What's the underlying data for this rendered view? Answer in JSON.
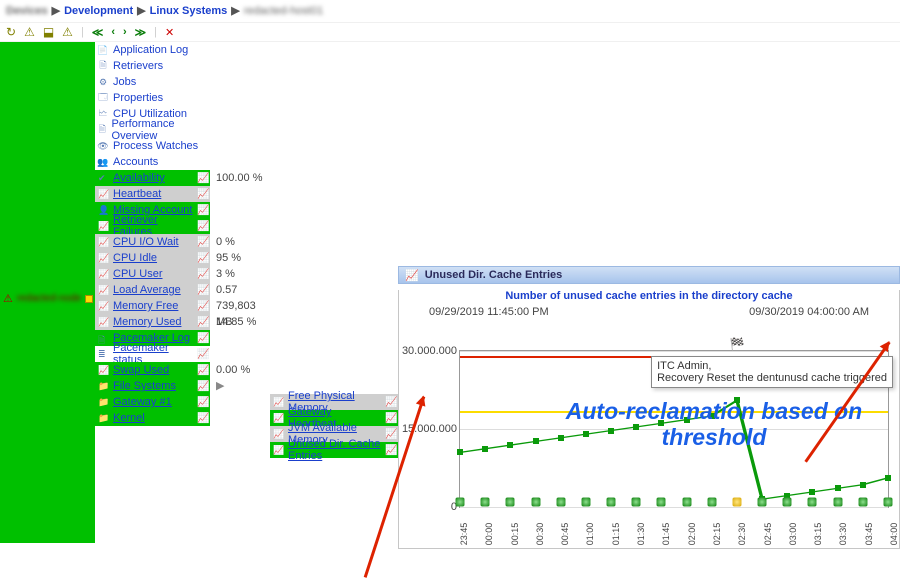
{
  "breadcrumb": {
    "l1": "Devices",
    "l2": "Development",
    "l3": "Linux Systems",
    "l4": "redacted-host01"
  },
  "tree": {
    "node": "redacted-node"
  },
  "nav_links": [
    {
      "icon": "📄",
      "label": "Application Log"
    },
    {
      "icon": "🗎",
      "label": "Retrievers"
    },
    {
      "icon": "⚙",
      "label": "Jobs"
    },
    {
      "icon": "🗔",
      "label": "Properties"
    },
    {
      "icon": "🗠",
      "label": "CPU Utilization"
    },
    {
      "icon": "🗎",
      "label": "Performance Overview"
    },
    {
      "icon": "👁",
      "label": "Process Watches"
    },
    {
      "icon": "👥",
      "label": "Accounts"
    }
  ],
  "metrics": [
    {
      "bg": "bg-green",
      "icon": "✔",
      "label": "Availability",
      "value": "100.00 %"
    },
    {
      "bg": "bg-grey",
      "icon": "📈",
      "label": "Heartbeat",
      "value": ""
    },
    {
      "bg": "bg-green",
      "icon": "👤",
      "label": "Missing Account",
      "value": ""
    },
    {
      "bg": "bg-green",
      "icon": "📈",
      "label": "Retriever Failures",
      "value": ""
    },
    {
      "bg": "bg-grey",
      "icon": "📈",
      "label": "CPU I/O Wait",
      "value": "0 %"
    },
    {
      "bg": "bg-grey",
      "icon": "📈",
      "label": "CPU Idle",
      "value": "95 %"
    },
    {
      "bg": "bg-grey",
      "icon": "📈",
      "label": "CPU User",
      "value": "3 %"
    },
    {
      "bg": "bg-grey",
      "icon": "📈",
      "label": "Load Average",
      "value": "0.57"
    },
    {
      "bg": "bg-grey",
      "icon": "📈",
      "label": "Memory Free",
      "value": "739,803 MB"
    },
    {
      "bg": "bg-grey",
      "icon": "📈",
      "label": "Memory Used",
      "value": "14.85 %"
    },
    {
      "bg": "bg-green",
      "icon": "🗎",
      "label": "Pacemaker Log",
      "value": ""
    },
    {
      "bg": "bg-white",
      "icon": "≣",
      "label": "Pacemaker status",
      "value": ""
    },
    {
      "bg": "bg-green",
      "icon": "📈",
      "label": "Swap Used",
      "value": "0.00 %"
    },
    {
      "bg": "bg-green",
      "icon": "📁",
      "label": "File Systems",
      "value": ""
    },
    {
      "bg": "bg-green",
      "icon": "📁",
      "label": "Gateway #1",
      "value": "",
      "tall": true
    },
    {
      "bg": "bg-green",
      "icon": "📁",
      "label": "Kernel",
      "value": ""
    }
  ],
  "sub_items": [
    {
      "bg": "bg-grey",
      "label": "Free Physical Memory"
    },
    {
      "bg": "bg-green",
      "label": "Gateway Heartbeat"
    },
    {
      "bg": "bg-grey",
      "label": "JVM Available Memory"
    },
    {
      "bg": "bg-green",
      "label": "Unused Dir. Cache Entries"
    }
  ],
  "chart_data": {
    "type": "line",
    "title": "Number of unused cache entries in the directory cache",
    "panel_title": "Unused Dir. Cache Entries",
    "ts_left": "09/29/2019 11:45:00 PM",
    "ts_right": "09/30/2019 04:00:00 AM",
    "ylabel": "",
    "ylim": [
      0,
      30000000
    ],
    "yticks": [
      0,
      15000000,
      30000000
    ],
    "yticklabels": [
      "0",
      "15.000.000",
      "30.000.000"
    ],
    "threshold_red": 29000000,
    "threshold_yellow": 18500000,
    "categories": [
      "23:45",
      "00:00",
      "00:15",
      "00:30",
      "00:45",
      "01:00",
      "01:15",
      "01:30",
      "01:45",
      "02:00",
      "02:15",
      "02:30",
      "02:45",
      "03:00",
      "03:15",
      "03:30",
      "03:45",
      "04:00"
    ],
    "series": [
      {
        "name": "entries",
        "values": [
          10500000,
          11200000,
          11900000,
          12600000,
          13300000,
          14000000,
          14700000,
          15400000,
          16100000,
          16800000,
          17500000,
          20500000,
          1500000,
          2200000,
          2900000,
          3600000,
          4300000,
          5600000
        ]
      }
    ],
    "markers": [
      {
        "x": 0,
        "status": "ok"
      },
      {
        "x": 1,
        "status": "ok"
      },
      {
        "x": 2,
        "status": "ok"
      },
      {
        "x": 3,
        "status": "ok"
      },
      {
        "x": 4,
        "status": "ok"
      },
      {
        "x": 5,
        "status": "ok"
      },
      {
        "x": 6,
        "status": "ok"
      },
      {
        "x": 7,
        "status": "ok"
      },
      {
        "x": 8,
        "status": "ok"
      },
      {
        "x": 9,
        "status": "ok"
      },
      {
        "x": 10,
        "status": "ok"
      },
      {
        "x": 11,
        "status": "warn"
      },
      {
        "x": 12,
        "status": "ok"
      },
      {
        "x": 13,
        "status": "ok"
      },
      {
        "x": 14,
        "status": "ok"
      },
      {
        "x": 15,
        "status": "ok"
      },
      {
        "x": 16,
        "status": "ok"
      },
      {
        "x": 17,
        "status": "ok"
      }
    ],
    "tooltip": {
      "line1": "ITC Admin,",
      "line2": "Recovery Reset the dentunusd cache triggered"
    },
    "annotation": "Auto-reclamation based on threshold"
  }
}
